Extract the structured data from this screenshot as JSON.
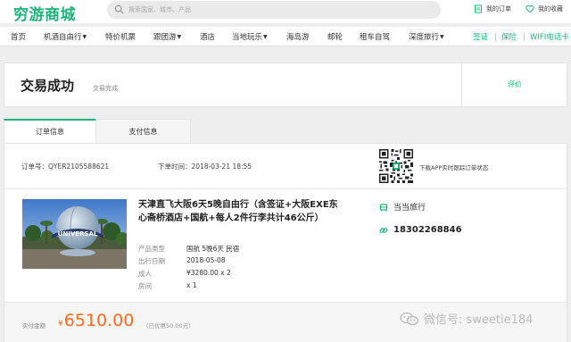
{
  "header": {
    "logo": "穷游商城",
    "search_placeholder": "搜索国家、城市、产品",
    "my_orders": "我的订单",
    "my_favorites": "我的收藏"
  },
  "nav": {
    "items": [
      {
        "label": "首页"
      },
      {
        "label": "机酒自由行"
      },
      {
        "label": "特价机票"
      },
      {
        "label": "跟团游"
      },
      {
        "label": "酒店"
      },
      {
        "label": "当地玩乐"
      },
      {
        "label": "海岛游"
      },
      {
        "label": "邮轮"
      },
      {
        "label": "租车自驾"
      },
      {
        "label": "深度旅行"
      }
    ],
    "right": [
      {
        "label": "签证"
      },
      {
        "label": "保险"
      },
      {
        "label": "WIFI电话卡"
      }
    ]
  },
  "status": {
    "title": "交易成功",
    "subtitle": "交易完成",
    "rate": "评价"
  },
  "tabs": {
    "order_info": "订单信息",
    "payment_info": "支付信息"
  },
  "order": {
    "order_no": "订单号：QYER2105588621",
    "order_time": "下单时间：2018-03-21 18:55",
    "qr_text": "下载APP实时跟踪订单状态"
  },
  "product": {
    "title": "天津直飞大阪6天5晚自由行（含签证+大阪EXE东心斋桥酒店+国航+每人2件行李共计46公斤）",
    "image_text": "UNIVERSAL",
    "details": [
      {
        "label": "产品类型",
        "value": "国航 5晚6天 民宿"
      },
      {
        "label": "出行日期",
        "value": "2018-05-08"
      },
      {
        "label": "成人",
        "value": "¥3280.00 x 2"
      },
      {
        "label": "房间",
        "value": "x 1"
      }
    ]
  },
  "vendor": {
    "name": "当当旅行",
    "phone": "18302268846"
  },
  "payment": {
    "label": "实付金额",
    "currency": "¥",
    "amount": "6510.00",
    "discount": "（已优惠50.00元）"
  },
  "watermark": "微信号: sweetie184",
  "colors": {
    "brand": "#19b67a",
    "price": "#ff6a1a"
  }
}
